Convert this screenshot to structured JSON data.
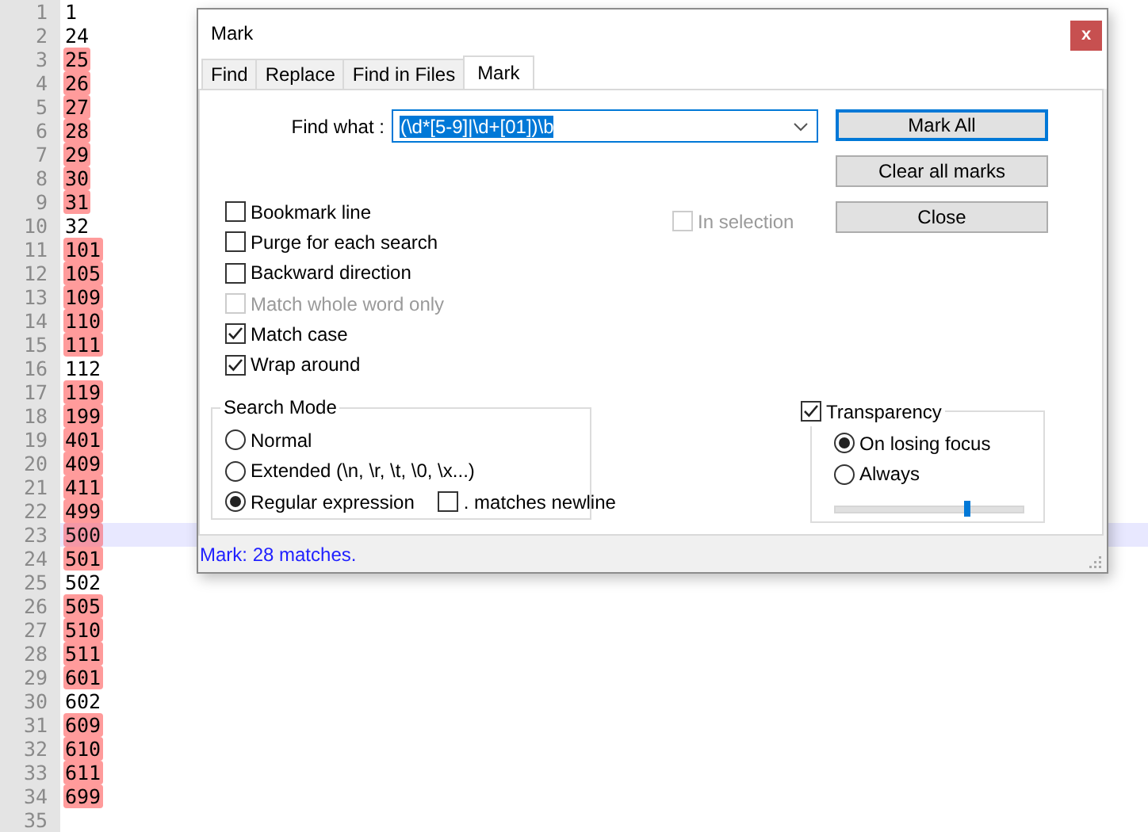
{
  "editor": {
    "lines": [
      {
        "number": "1",
        "text": "1",
        "marked": false,
        "current": false
      },
      {
        "number": "2",
        "text": "24",
        "marked": false,
        "current": false
      },
      {
        "number": "3",
        "text": "25",
        "marked": true,
        "current": false
      },
      {
        "number": "4",
        "text": "26",
        "marked": true,
        "current": false
      },
      {
        "number": "5",
        "text": "27",
        "marked": true,
        "current": false
      },
      {
        "number": "6",
        "text": "28",
        "marked": true,
        "current": false
      },
      {
        "number": "7",
        "text": "29",
        "marked": true,
        "current": false
      },
      {
        "number": "8",
        "text": "30",
        "marked": true,
        "current": false
      },
      {
        "number": "9",
        "text": "31",
        "marked": true,
        "current": false
      },
      {
        "number": "10",
        "text": "32",
        "marked": false,
        "current": false
      },
      {
        "number": "11",
        "text": "101",
        "marked": true,
        "current": false
      },
      {
        "number": "12",
        "text": "105",
        "marked": true,
        "current": false
      },
      {
        "number": "13",
        "text": "109",
        "marked": true,
        "current": false
      },
      {
        "number": "14",
        "text": "110",
        "marked": true,
        "current": false
      },
      {
        "number": "15",
        "text": "111",
        "marked": true,
        "current": false
      },
      {
        "number": "16",
        "text": "112",
        "marked": false,
        "current": false
      },
      {
        "number": "17",
        "text": "119",
        "marked": true,
        "current": false
      },
      {
        "number": "18",
        "text": "199",
        "marked": true,
        "current": false
      },
      {
        "number": "19",
        "text": "401",
        "marked": true,
        "current": false
      },
      {
        "number": "20",
        "text": "409",
        "marked": true,
        "current": false
      },
      {
        "number": "21",
        "text": "411",
        "marked": true,
        "current": false
      },
      {
        "number": "22",
        "text": "499",
        "marked": true,
        "current": false
      },
      {
        "number": "23",
        "text": "500",
        "marked": true,
        "current": true
      },
      {
        "number": "24",
        "text": "501",
        "marked": true,
        "current": false
      },
      {
        "number": "25",
        "text": "502",
        "marked": false,
        "current": false
      },
      {
        "number": "26",
        "text": "505",
        "marked": true,
        "current": false
      },
      {
        "number": "27",
        "text": "510",
        "marked": true,
        "current": false
      },
      {
        "number": "28",
        "text": "511",
        "marked": true,
        "current": false
      },
      {
        "number": "29",
        "text": "601",
        "marked": true,
        "current": false
      },
      {
        "number": "30",
        "text": "602",
        "marked": false,
        "current": false
      },
      {
        "number": "31",
        "text": "609",
        "marked": true,
        "current": false
      },
      {
        "number": "32",
        "text": "610",
        "marked": true,
        "current": false
      },
      {
        "number": "33",
        "text": "611",
        "marked": true,
        "current": false
      },
      {
        "number": "34",
        "text": "699",
        "marked": true,
        "current": false
      },
      {
        "number": "35"
      }
    ]
  },
  "dialog": {
    "title": "Mark",
    "close": "x",
    "tabs": [
      {
        "label": "Find",
        "selected": false
      },
      {
        "label": "Replace",
        "selected": false
      },
      {
        "label": "Find in Files",
        "selected": false
      },
      {
        "label": "Mark",
        "selected": true
      }
    ],
    "find_what": {
      "label": "Find what :",
      "value": "(\\d*[5-9]|\\d+[01])\\b",
      "value_selected": true
    },
    "buttons": [
      {
        "label": "Mark All",
        "focused": true
      },
      {
        "label": "Clear all marks",
        "focused": false
      },
      {
        "label": "Close",
        "focused": false
      }
    ],
    "options": [
      {
        "label": "Bookmark line",
        "checked": false,
        "disabled": false
      },
      {
        "label": "Purge for each search",
        "checked": false,
        "disabled": false
      },
      {
        "label": "Backward direction",
        "checked": false,
        "disabled": false
      },
      {
        "label": "Match whole word only",
        "checked": false,
        "disabled": true
      },
      {
        "label": "Match case",
        "checked": true,
        "disabled": false
      },
      {
        "label": "Wrap around",
        "checked": true,
        "disabled": false
      }
    ],
    "in_selection": {
      "label": "In selection",
      "checked": false,
      "disabled": true
    },
    "search_mode": {
      "title": "Search Mode",
      "modes": [
        {
          "label": "Normal",
          "selected": false
        },
        {
          "label": "Extended (\\n, \\r, \\t, \\0, \\x...)",
          "selected": false
        },
        {
          "label": "Regular expression",
          "selected": true
        }
      ],
      "matches_newline": {
        "label": ". matches newline",
        "checked": false
      }
    },
    "transparency": {
      "label": "Transparency",
      "checked": true,
      "modes": [
        {
          "label": "On losing focus",
          "selected": true
        },
        {
          "label": "Always",
          "selected": false
        }
      ],
      "level": 0.7
    },
    "status": "Mark: 28 matches."
  }
}
